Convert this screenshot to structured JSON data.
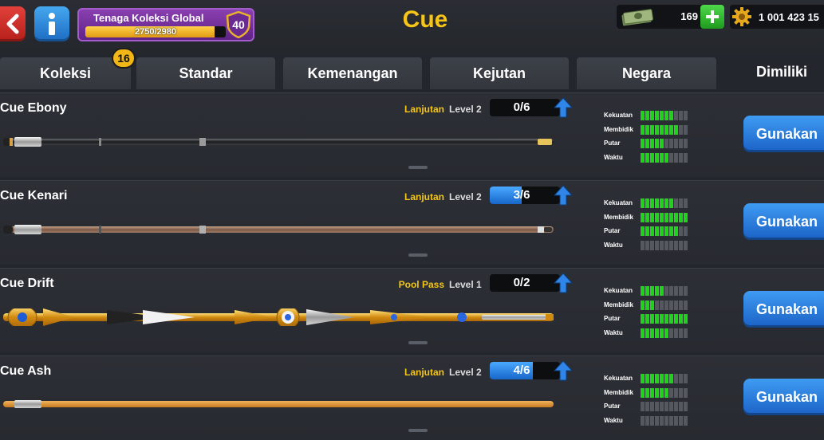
{
  "header": {
    "title": "Cue",
    "back_icon": "back-arrow-icon",
    "info_icon": "info-icon",
    "collection_power": {
      "label": "Tenaga Koleksi Global",
      "progress_text": "2750/2980",
      "current": 2750,
      "max": 2980,
      "level": "40"
    },
    "cash": {
      "value": "169",
      "icon": "cash-stack-icon"
    },
    "add_icon": "plus-icon",
    "coins": {
      "value": "1 001 423 15",
      "icon": "coin-gear-icon"
    }
  },
  "tabs": [
    {
      "label": "Koleksi",
      "active": false
    },
    {
      "label": "Standar",
      "active": false
    },
    {
      "label": "Kemenangan",
      "active": false
    },
    {
      "label": "Kejutan",
      "active": false
    },
    {
      "label": "Negara",
      "active": false
    },
    {
      "label": "Dimiliki",
      "active": true
    }
  ],
  "koleksi_badge": "16",
  "colors": {
    "accent_yellow": "#f5c518",
    "button_blue": "#2a7fdc",
    "stat_green": "#22d01e",
    "back_red": "#d2322c",
    "panel_purple": "#7a33a3"
  },
  "stat_labels": {
    "power": "Kekuatan",
    "aim": "Membidik",
    "spin": "Putar",
    "time": "Waktu"
  },
  "cues": [
    {
      "name": "Cue Ebony",
      "type": "Lanjutan",
      "level": "Level 2",
      "progress_text": "0/6",
      "progress": 0,
      "stats": {
        "power": 7,
        "aim": 8,
        "spin": 5,
        "time": 6
      },
      "button": "Gunakan"
    },
    {
      "name": "Cue Kenari",
      "type": "Lanjutan",
      "level": "Level 2",
      "progress_text": "3/6",
      "progress": 0.5,
      "stats": {
        "power": 7,
        "aim": 10,
        "spin": 8,
        "time": 0
      },
      "button": "Gunakan"
    },
    {
      "name": "Cue Drift",
      "type": "Pool Pass",
      "level": "Level 1",
      "progress_text": "0/2",
      "progress": 0,
      "stats": {
        "power": 5,
        "aim": 3,
        "spin": 10,
        "time": 6
      },
      "button": "Gunakan"
    },
    {
      "name": "Cue Ash",
      "type": "Lanjutan",
      "level": "Level 2",
      "progress_text": "4/6",
      "progress": 0.67,
      "stats": {
        "power": 7,
        "aim": 6,
        "spin": 0,
        "time": 0
      },
      "button": "Gunakan"
    }
  ]
}
